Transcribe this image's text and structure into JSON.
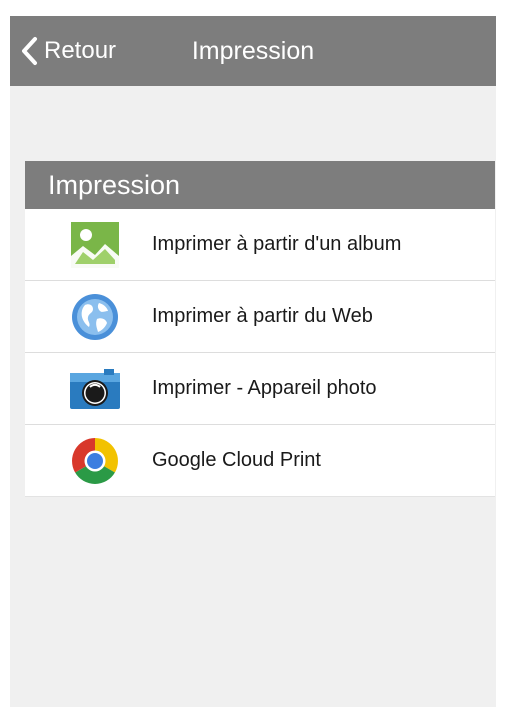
{
  "nav": {
    "back_label": "Retour",
    "title": "Impression"
  },
  "section": {
    "header": "Impression",
    "items": [
      {
        "label": "Imprimer à partir d'un album",
        "icon": "photo-album-icon"
      },
      {
        "label": "Imprimer à partir du Web",
        "icon": "globe-icon"
      },
      {
        "label": "Imprimer - Appareil photo",
        "icon": "camera-icon"
      },
      {
        "label": "Google Cloud Print",
        "icon": "chrome-icon"
      }
    ]
  },
  "colors": {
    "bar": "#7d7d7d",
    "background": "#f0f0f0",
    "album_icon": "#7ab648",
    "globe_icon": "#4a90d9",
    "camera_icon": "#2a7bbf"
  }
}
